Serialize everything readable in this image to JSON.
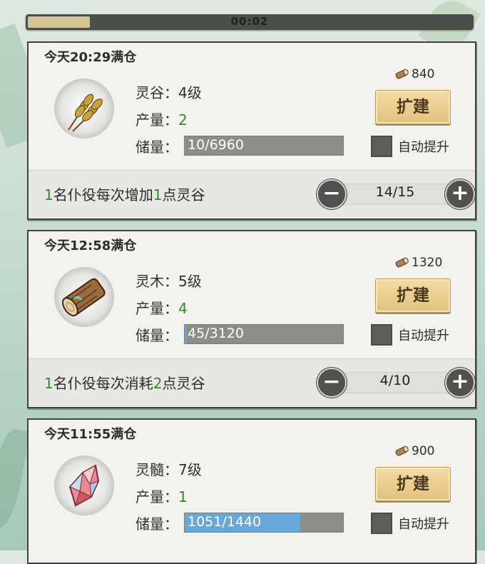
{
  "timer": {
    "text": "00:02",
    "progress": 0.14
  },
  "cards": [
    {
      "full_time": "今天20:29满仓",
      "icon": "grain-icon",
      "name_label": "灵谷：",
      "level": "4级",
      "output_label": "产量：",
      "output": "2",
      "storage_label": "储量：",
      "storage": "10/6960",
      "storage_fraction": 0.0014,
      "cost": "840",
      "expand_label": "扩建",
      "auto_label": "自动提升",
      "worker_num1": "1",
      "worker_text1": "名仆役每次增加",
      "worker_num2": "1",
      "worker_text2": "点灵谷",
      "stepper_value": "14/15",
      "minus": "−",
      "plus": "+"
    },
    {
      "full_time": "今天12:58满仓",
      "icon": "wood-log-icon",
      "name_label": "灵木：",
      "level": "5级",
      "output_label": "产量：",
      "output": "4",
      "storage_label": "储量：",
      "storage": "45/3120",
      "storage_fraction": 0.014,
      "cost": "1320",
      "expand_label": "扩建",
      "auto_label": "自动提升",
      "worker_num1": "1",
      "worker_text1": "名仆役每次消耗",
      "worker_num2": "2",
      "worker_text2": "点灵谷",
      "stepper_value": "4/10",
      "minus": "−",
      "plus": "+"
    },
    {
      "full_time": "今天11:55满仓",
      "icon": "crystal-icon",
      "name_label": "灵髓：",
      "level": "7级",
      "output_label": "产量：",
      "output": "1",
      "storage_label": "储量：",
      "storage": "1051/1440",
      "storage_fraction": 0.73,
      "cost": "900",
      "expand_label": "扩建",
      "auto_label": "自动提升"
    }
  ],
  "colors": {
    "green": "#2f8a2c",
    "storage_fill": "#6aa7d9",
    "button": "#e2c07c"
  }
}
